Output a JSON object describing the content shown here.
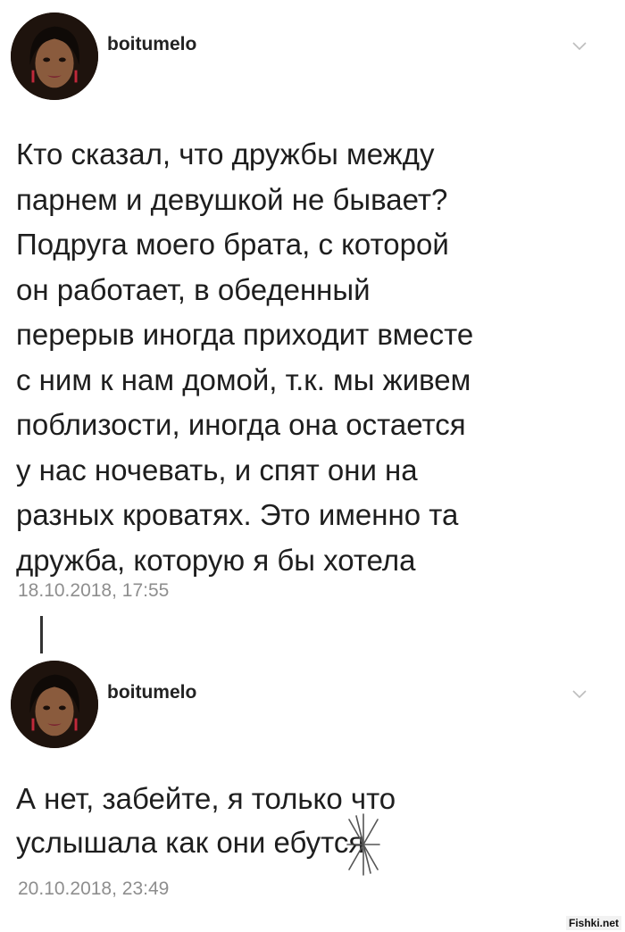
{
  "posts": [
    {
      "username": "boitumelo",
      "avatar": "profile-photo",
      "menu_icon": "chevron-down-icon",
      "text": "Кто сказал, что дружбы между\nпарнем и девушкой не бывает?\nПодруга моего брата, с которой\nон работает, в обеденный\nперерыв иногда приходит вместе\nс ним к нам домой, т.к. мы живем\nпоблизости, иногда она остается\nу нас ночевать, и спят они на\nразных кроватях. Это именно та\nдружба, которую я бы хотела",
      "timestamp": "18.10.2018, 17:55"
    },
    {
      "username": "boitumelo",
      "avatar": "profile-photo",
      "menu_icon": "chevron-down-icon",
      "text": "А нет, забейте, я только что\nуслышала как они ебутся",
      "timestamp": "20.10.2018, 23:49"
    }
  ],
  "watermark": "Fishki.net",
  "colors": {
    "text": "#1e1e1e",
    "timestamp": "#8e8e8e",
    "background": "#ffffff"
  }
}
